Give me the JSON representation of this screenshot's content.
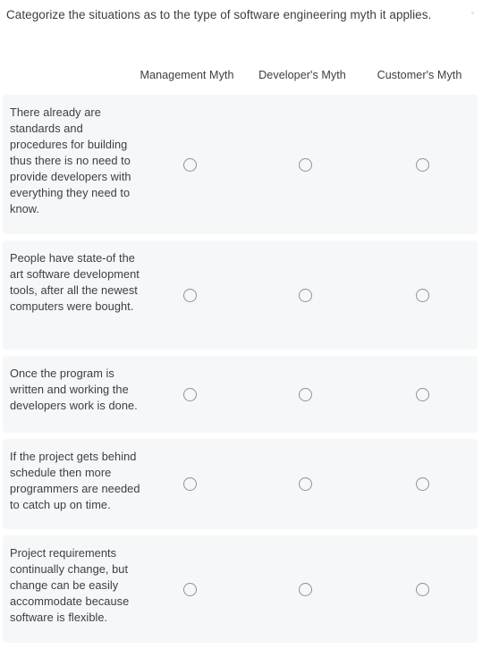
{
  "question": {
    "prompt": "Categorize the situations as to the type of software engineering myth it applies."
  },
  "matrix": {
    "columns": [
      {
        "label": "Management Myth"
      },
      {
        "label": "Developer's Myth"
      },
      {
        "label": "Customer's Myth"
      }
    ],
    "rows": [
      {
        "statement": "There already are standards and procedures for building thus there is no need to provide developers with everything they need to know.",
        "selected": null
      },
      {
        "statement": "People have state-of the art software development tools, after all the newest computers were bought.",
        "selected": null
      },
      {
        "statement": "Once the program is written and working the developers work is done.",
        "selected": null
      },
      {
        "statement": "If the project gets behind schedule then more programmers are needed to catch up on time.",
        "selected": null
      },
      {
        "statement": "Project requirements continually change, but change can be easily accommodate because software is flexible.",
        "selected": null
      }
    ]
  },
  "style": {
    "text_color": "#3c4043",
    "row_background": "#f6f7f9",
    "page_background": "#ffffff",
    "radio_border_color": "#8d9399"
  }
}
